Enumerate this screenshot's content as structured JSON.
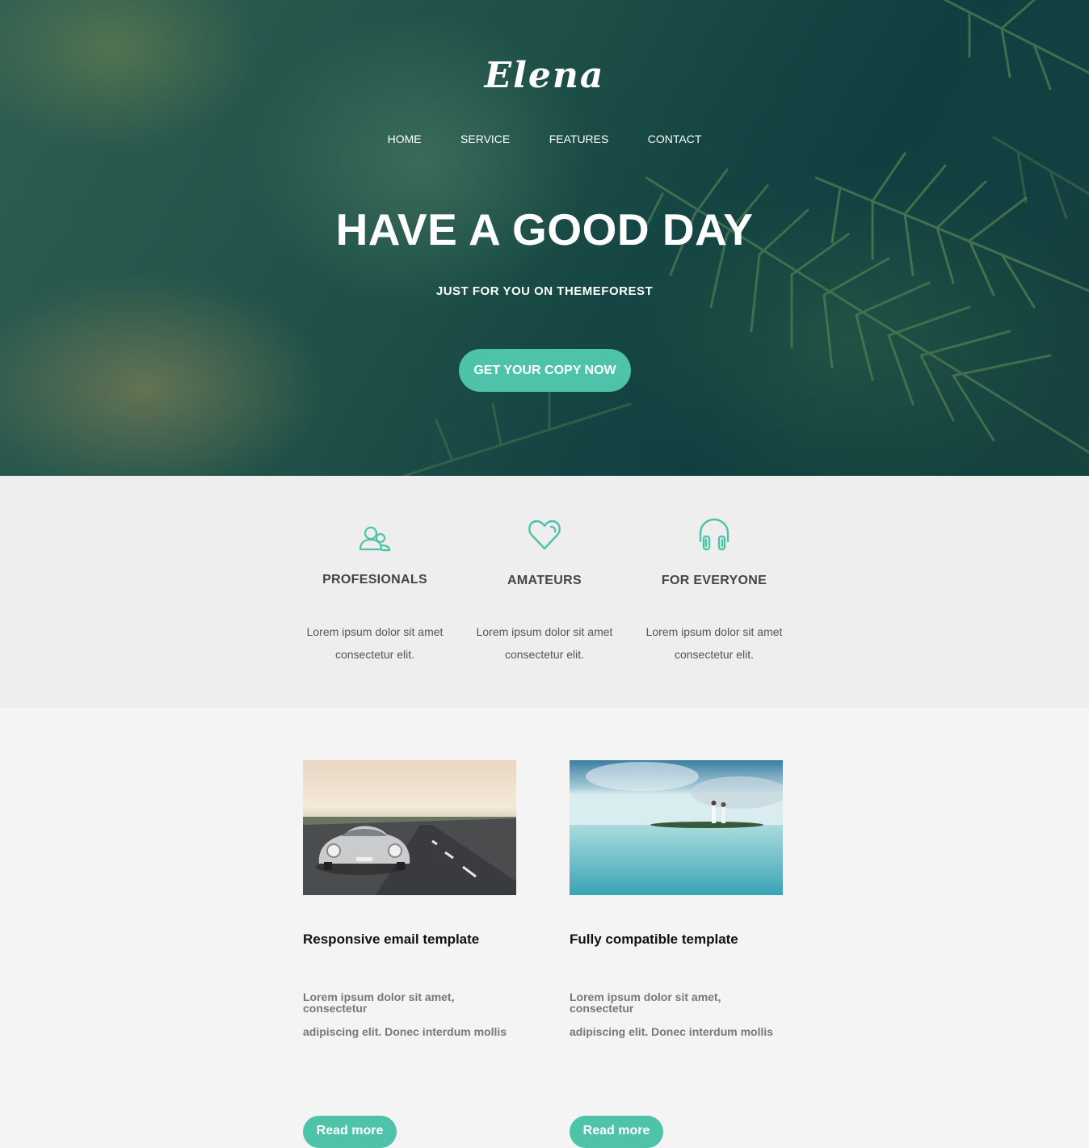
{
  "brand": {
    "logo": "Elena"
  },
  "nav": {
    "items": [
      "HOME",
      "SERVICE",
      "FEATURES",
      "CONTACT"
    ]
  },
  "hero": {
    "headline": "HAVE A GOOD DAY",
    "subline": "JUST FOR YOU ON THEMEFOREST",
    "cta_label": "GET YOUR COPY NOW"
  },
  "features": [
    {
      "icon": "users-icon",
      "title": "PROFESIONALS",
      "desc_line1": "Lorem ipsum dolor sit amet",
      "desc_line2": "consectetur elit."
    },
    {
      "icon": "heart-icon",
      "title": "AMATEURS",
      "desc_line1": "Lorem ipsum dolor sit amet",
      "desc_line2": "consectetur elit."
    },
    {
      "icon": "headphones-icon",
      "title": "FOR EVERYONE",
      "desc_line1": "Lorem ipsum dolor sit amet",
      "desc_line2": "consectetur elit."
    }
  ],
  "articles": [
    {
      "image": "vintage-car-photo",
      "title": "Responsive email template",
      "text_line1": "Lorem ipsum dolor sit amet, consectetur",
      "text_line2": "adipiscing elit. Donec interdum mollis",
      "button": "Read more"
    },
    {
      "image": "beach-couple-photo",
      "title": "Fully compatible template",
      "text_line1": "Lorem ipsum dolor sit amet, consectetur",
      "text_line2": "adipiscing elit. Donec interdum mollis",
      "button": "Read more"
    }
  ],
  "colors": {
    "accent": "#4fc3aa",
    "hero_dark": "#16423f",
    "features_bg": "#eeeeee",
    "page_bg": "#f4f4f4"
  }
}
